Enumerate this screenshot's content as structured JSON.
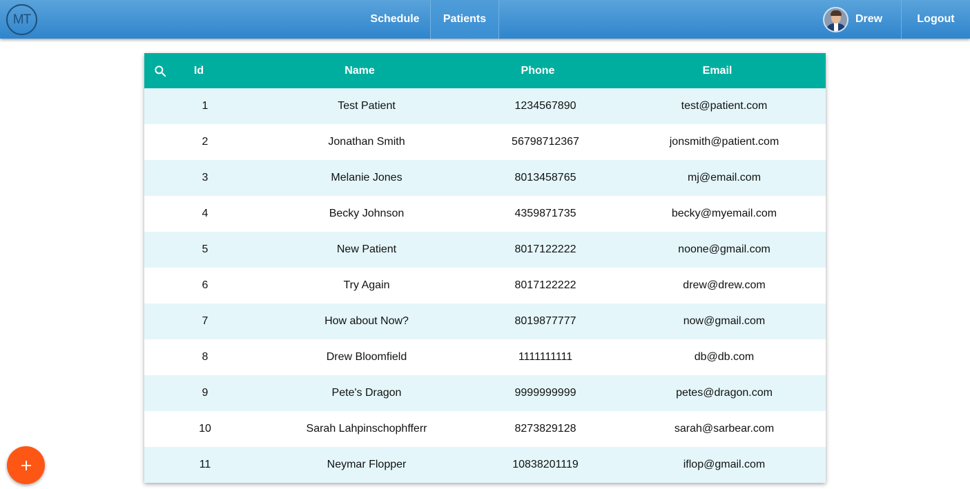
{
  "app": {
    "logo_text": "MT"
  },
  "nav": {
    "schedule_label": "Schedule",
    "patients_label": "Patients",
    "active_tab": "Patients",
    "user_name": "Drew",
    "logout_label": "Logout"
  },
  "table": {
    "search_icon": "search-icon",
    "headers": {
      "id": "Id",
      "name": "Name",
      "phone": "Phone",
      "email": "Email"
    },
    "rows": [
      {
        "id": "1",
        "name": "Test Patient",
        "phone": "1234567890",
        "email": "test@patient.com"
      },
      {
        "id": "2",
        "name": "Jonathan Smith",
        "phone": "56798712367",
        "email": "jonsmith@patient.com"
      },
      {
        "id": "3",
        "name": "Melanie Jones",
        "phone": "8013458765",
        "email": "mj@email.com"
      },
      {
        "id": "4",
        "name": "Becky Johnson",
        "phone": "4359871735",
        "email": "becky@myemail.com"
      },
      {
        "id": "5",
        "name": "New Patient",
        "phone": "8017122222",
        "email": "noone@gmail.com"
      },
      {
        "id": "6",
        "name": "Try Again",
        "phone": "8017122222",
        "email": "drew@drew.com"
      },
      {
        "id": "7",
        "name": "How about Now?",
        "phone": "8019877777",
        "email": "now@gmail.com"
      },
      {
        "id": "8",
        "name": "Drew Bloomfield",
        "phone": "1111111111",
        "email": "db@db.com"
      },
      {
        "id": "9",
        "name": "Pete's Dragon",
        "phone": "9999999999",
        "email": "petes@dragon.com"
      },
      {
        "id": "10",
        "name": "Sarah Lahpinschophfferr",
        "phone": "8273829128",
        "email": "sarah@sarbear.com"
      },
      {
        "id": "11",
        "name": "Neymar Flopper",
        "phone": "10838201119",
        "email": "iflop@gmail.com"
      }
    ]
  },
  "fab": {
    "icon": "plus-icon"
  },
  "colors": {
    "topbar": "#3a8ed3",
    "table_header": "#00ae9f",
    "row_alt": "#e4f6fa",
    "fab": "#fe5615"
  }
}
